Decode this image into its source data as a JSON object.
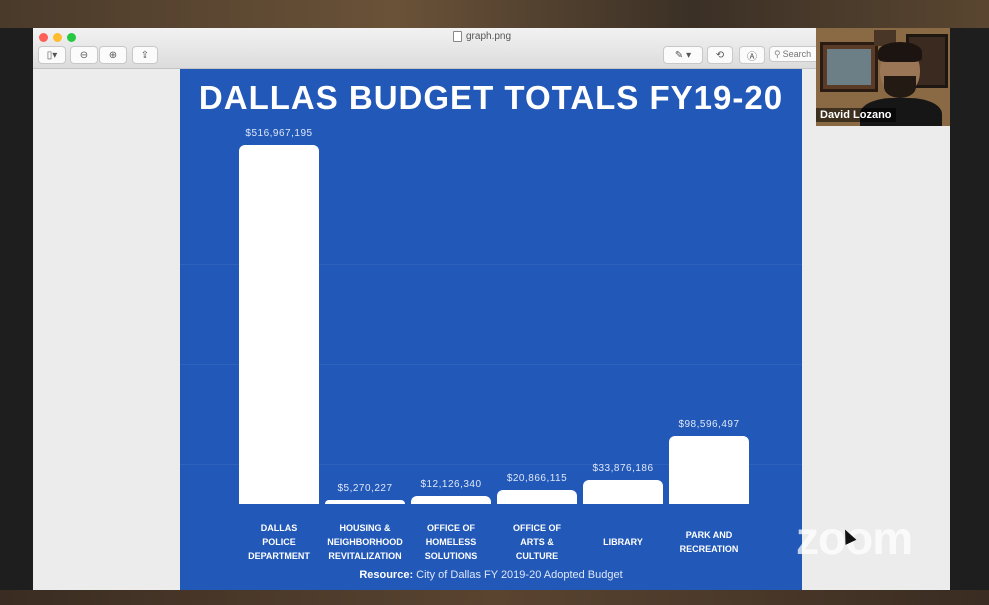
{
  "window": {
    "title": "graph.png",
    "search_placeholder": "Search"
  },
  "slide": {
    "title": "DALLAS BUDGET TOTALS  FY19-20",
    "resource_label": "Resource:",
    "resource_text": "City of Dallas FY 2019-20 Adopted Budget"
  },
  "chart_data": {
    "type": "bar",
    "title": "DALLAS BUDGET TOTALS  FY19-20",
    "categories": [
      "DALLAS\nPOLICE\nDEPARTMENT",
      "HOUSING &\nNEIGHBORHOOD\nREVITALIZATION",
      "OFFICE OF\nHOMELESS\nSOLUTIONS",
      "OFFICE OF\nARTS &\nCULTURE",
      "LIBRARY",
      "PARK AND\nRECREATION"
    ],
    "values": [
      516967195,
      5270227,
      12126340,
      20866115,
      33876186,
      98596497
    ],
    "value_labels": [
      "$516,967,195",
      "$5,270,227",
      "$12,126,340",
      "$20,866,115",
      "$33,876,186",
      "$98,596,497"
    ],
    "ylim": [
      0,
      516967195
    ],
    "grid": false,
    "bar_color": "#ffffff",
    "background_color": "#2259b8"
  },
  "video": {
    "participant_name": "David Lozano",
    "watermark": "zoom"
  },
  "colors": {
    "slide_bg": "#2259b8",
    "window_bg": "#ececec"
  }
}
